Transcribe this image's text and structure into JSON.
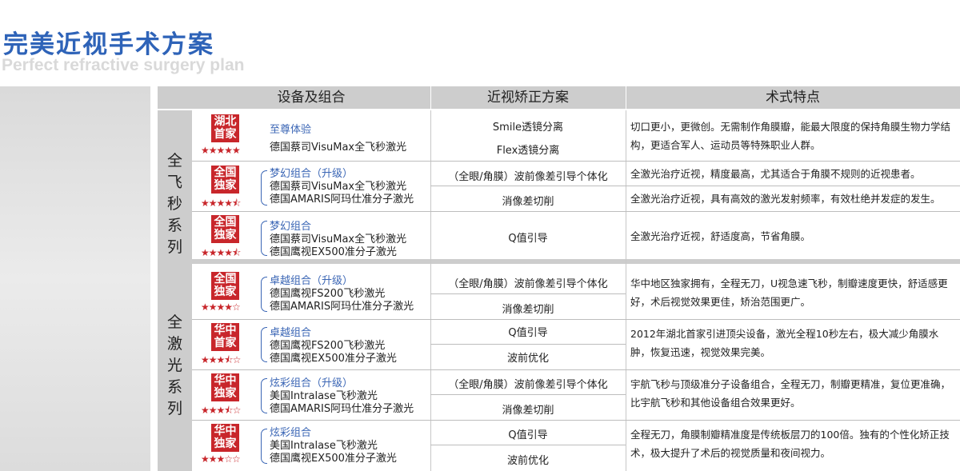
{
  "page": {
    "title_cn": "完美近视手术方案",
    "title_en": "Perfect refractive surgery plan"
  },
  "table": {
    "headers": [
      "设备及组合",
      "近视矫正方案",
      "术式特点"
    ],
    "series": [
      "全飞秒系列",
      "全激光系列"
    ],
    "rows": [
      {
        "badge": [
          "湖北",
          "首家"
        ],
        "stars": "★★★★★",
        "rating": 5,
        "combo": "至尊体验",
        "devices": [
          "德国蔡司VisuMax全飞秒激光"
        ],
        "plans": [
          "Smile透镜分离",
          "Flex透镜分离"
        ],
        "features": [
          "切口更小，更微创。无需制作角膜瓣，能最大限度的保持角膜生物力学结构，更适合军人、运动员等特殊职业人群。"
        ]
      },
      {
        "badge": [
          "全国",
          "独家"
        ],
        "stars": "★★★★⯪",
        "rating": 4.5,
        "combo": "梦幻组合（升级）",
        "devices": [
          "德国蔡司VisuMax全飞秒激光",
          "德国AMARIS阿玛仕准分子激光"
        ],
        "plans": [
          "（全眼/角膜）波前像差引导个体化",
          "消像差切削"
        ],
        "features": [
          "全激光治疗近视，精度最高，尤其适合于角膜不规则的近视患者。",
          "全激光治疗近视，具有高效的激光发射频率，有效杜绝并发症的发生。"
        ]
      },
      {
        "badge": [
          "全国",
          "独家"
        ],
        "stars": "★★★★⯪",
        "rating": 4.5,
        "combo": "梦幻组合",
        "devices": [
          "德国蔡司VisuMax全飞秒激光",
          "德国鹰视EX500准分子激光"
        ],
        "plans": [
          "Q值引导"
        ],
        "features": [
          "全激光治疗近视，舒适度高，节省角膜。"
        ]
      },
      {
        "badge": [
          "全国",
          "独家"
        ],
        "stars": "★★★★☆",
        "rating": 4,
        "combo": "卓越组合（升级）",
        "devices": [
          "德国鹰视FS200飞秒激光",
          "德国AMARIS阿玛仕准分子激光"
        ],
        "plans": [
          "（全眼/角膜）波前像差引导个体化",
          "消像差切削"
        ],
        "features": [
          "华中地区独家拥有，全程无刀，U视急速飞秒，制瓣速度更快，舒适感更好，术后视觉效果更佳，矫治范围更广。"
        ]
      },
      {
        "badge": [
          "华中",
          "首家"
        ],
        "stars": "★★★⯪☆",
        "rating": 3.5,
        "combo": "卓越组合",
        "devices": [
          "德国鹰视FS200飞秒激光",
          "德国鹰视EX500准分子激光"
        ],
        "plans": [
          "Q值引导",
          "波前优化"
        ],
        "features": [
          "2012年湖北首家引进顶尖设备，激光全程10秒左右，极大减少角膜水肿，恢复迅速，视觉效果完美。"
        ]
      },
      {
        "badge": [
          "华中",
          "独家"
        ],
        "stars": "★★★⯪☆",
        "rating": 3.5,
        "combo": "炫彩组合（升级）",
        "devices": [
          "美国Intralase飞秒激光",
          "德国AMARIS阿玛仕准分子激光"
        ],
        "plans": [
          "（全眼/角膜）波前像差引导个体化",
          "消像差切削"
        ],
        "features": [
          "宇航飞秒与顶级准分子设备组合，全程无刀，制瓣更精准，复位更准确，比宇航飞秒和其他设备组合效果更好。"
        ]
      },
      {
        "badge": [
          "华中",
          "独家"
        ],
        "stars": "★★★☆☆",
        "rating": 3,
        "combo": "炫彩组合",
        "devices": [
          "美国Intralase飞秒激光",
          "德国鹰视EX500准分子激光"
        ],
        "plans": [
          "Q值引导",
          "波前优化"
        ],
        "features": [
          "全程无刀，角膜制瓣精准度是传统板层刀的100倍。独有的个性化矫正技术，极大提升了术后的视觉质量和夜间视力。"
        ]
      }
    ]
  },
  "colors": {
    "accent": "#2e63b8",
    "badge_red": "#c8262b",
    "header_gray": "#cdcdcd"
  }
}
